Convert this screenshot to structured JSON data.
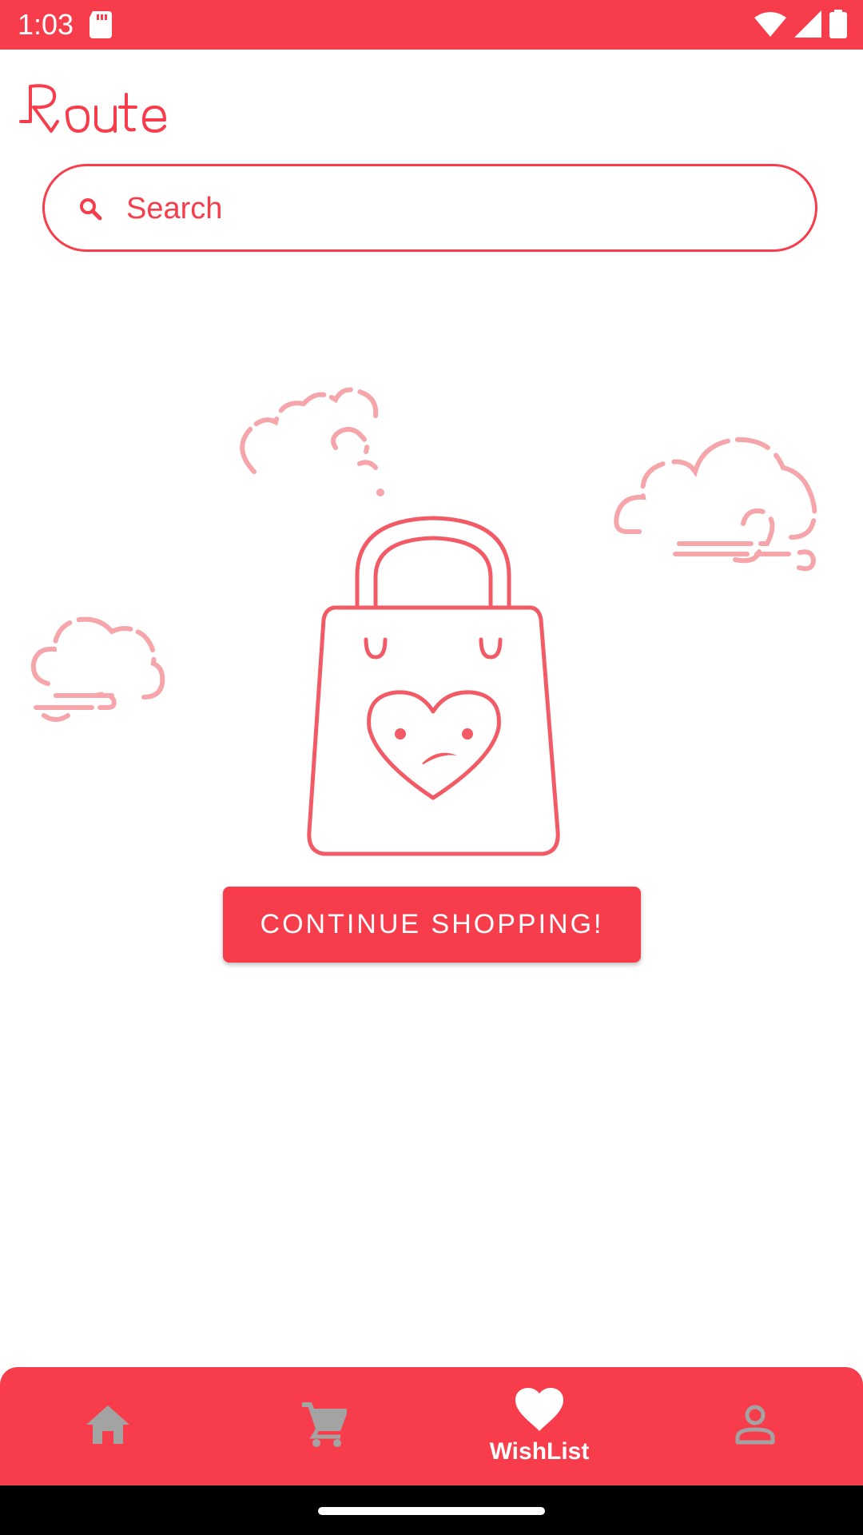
{
  "status_bar": {
    "time": "1:03",
    "background": "#f73d4b",
    "icons": [
      "sd-card-icon",
      "wifi-icon",
      "signal-icon",
      "battery-icon"
    ]
  },
  "logo": {
    "text": "Route",
    "color": "#f73d4b"
  },
  "search": {
    "placeholder": "Search",
    "value": "",
    "icon": "search-icon"
  },
  "empty_state": {
    "illustration": "empty-wishlist-bag-with-clouds",
    "button_label": "CONTINUE SHOPPING!"
  },
  "bottom_nav": {
    "items": [
      {
        "id": "home",
        "icon": "home-icon",
        "label": "",
        "active": false
      },
      {
        "id": "cart",
        "icon": "cart-icon",
        "label": "",
        "active": false
      },
      {
        "id": "wishlist",
        "icon": "heart-icon",
        "label": "WishList",
        "active": true
      },
      {
        "id": "profile",
        "icon": "profile-icon",
        "label": "",
        "active": false
      }
    ]
  },
  "colors": {
    "primary": "#f73d4b",
    "inactive_icon": "#a3a3a3",
    "illustration_stroke": "#f25b66",
    "cloud_stroke": "#f6a6ab"
  }
}
